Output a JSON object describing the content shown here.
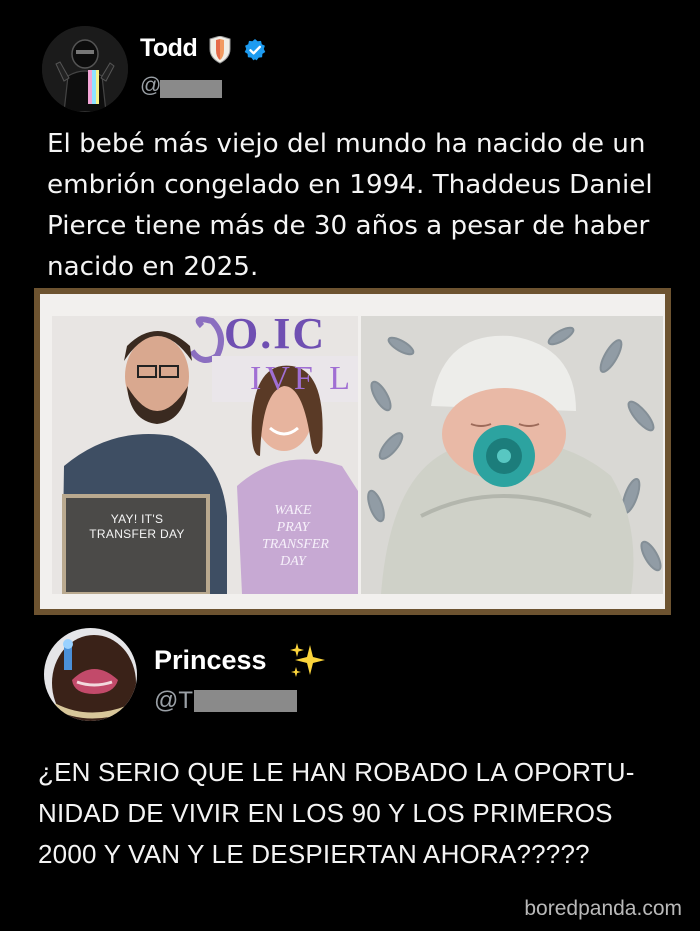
{
  "tweet1": {
    "name": "Todd",
    "handle_prefix": "@",
    "text": "El bebé más viejo del mundo ha nacido de un embrión congelado en 1994. Thaddeus Daniel Pierce tiene más de 30 años a pesar de haber nacido en 2025.",
    "image": {
      "logo_partial": "O.IC",
      "clinic_partial": "IVF L",
      "board_text": "YAY! IT'S TRANSFER DAY",
      "shirt_text": "WAKE PRAY TRANSFER DAY"
    }
  },
  "tweet2": {
    "name": "Princess",
    "handle_prefix": "@T",
    "text": "¿EN SERIO QUE LE HAN ROBADO LA OPORTU-NIDAD DE VIVIR EN LOS 90 Y LOS PRIMEROS 2000 Y VAN Y LE DESPIERTAN AHORA?????"
  },
  "watermark": "boredpanda.com",
  "colors": {
    "background": "#000000",
    "verified": "#1d9bf0",
    "handle": "#9aa0a6",
    "frame": "#6d5330"
  },
  "icons": [
    "shield-emoji-icon",
    "verified-badge-icon",
    "sparkles-icon"
  ]
}
